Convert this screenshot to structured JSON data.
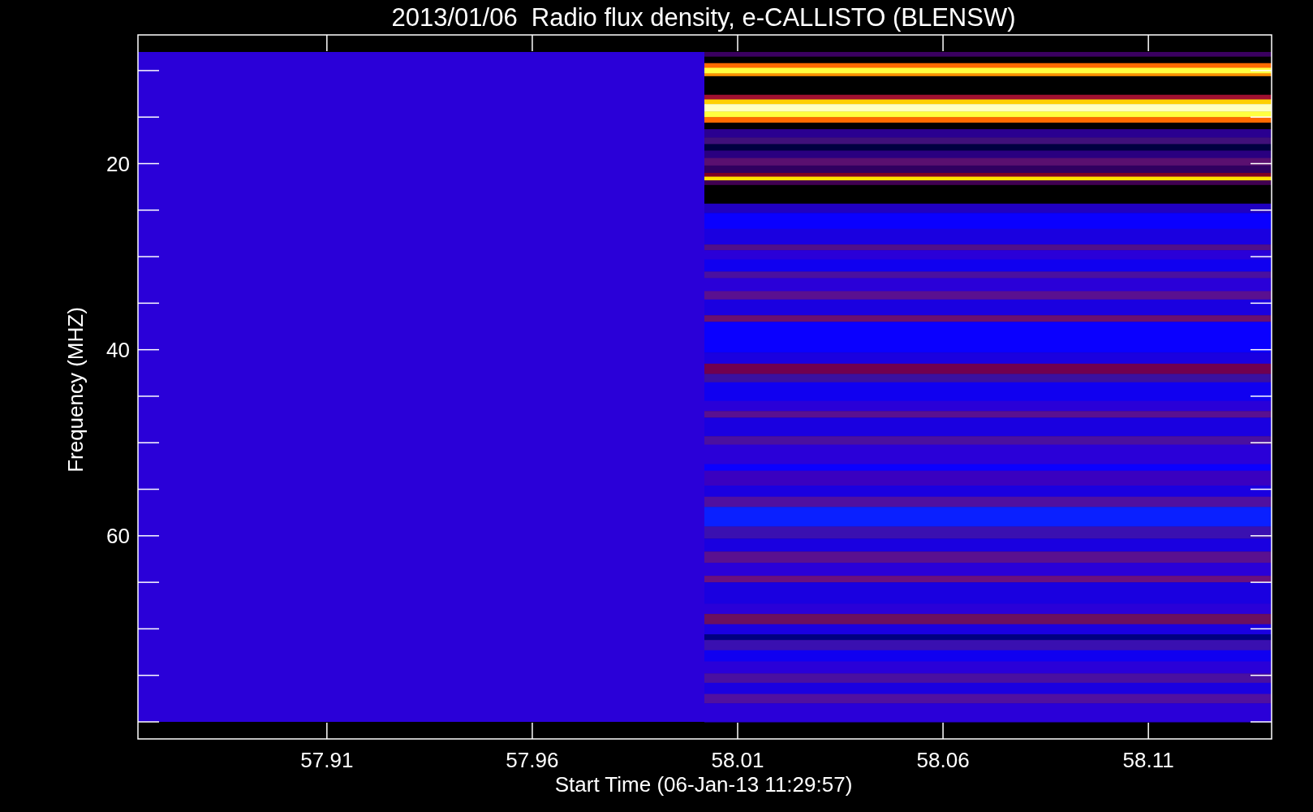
{
  "title": "2013/01/06  Radio flux density, e-CALLISTO (BLENSW)",
  "plot": {
    "xlabel": "Start Time (06-Jan-13 11:29:57)",
    "ylabel": "Frequency (MHZ)",
    "xticks": [
      "57.91",
      "57.96",
      "58.01",
      "58.06",
      "58.11"
    ],
    "yticks": [
      "20",
      "40",
      "60"
    ]
  }
}
